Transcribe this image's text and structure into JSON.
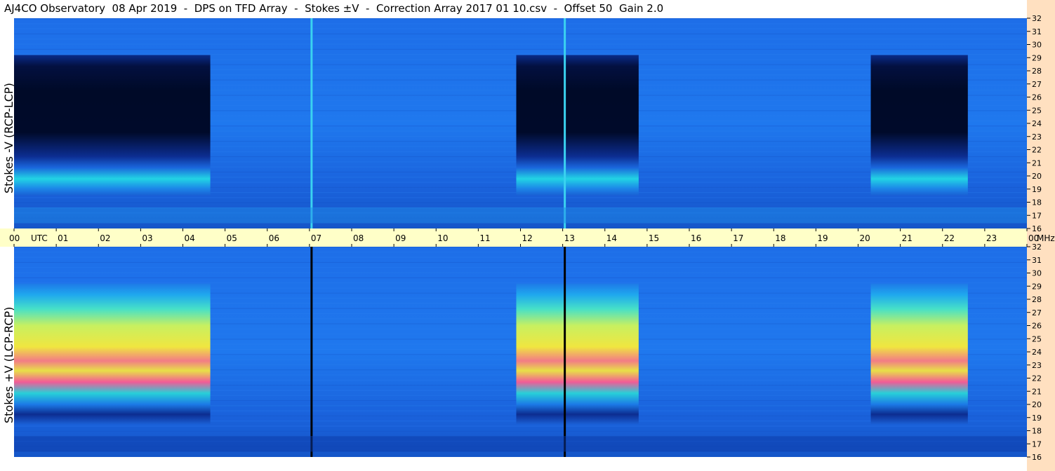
{
  "title": "AJ4CO Observatory  08 Apr 2019  -  DPS on TFD Array  -  Stokes ±V  -  Correction Array 2017 01 10.csv  -  Offset 50  Gain 2.0",
  "panels": {
    "top_label": "Stokes -V (RCP-LCP)",
    "bottom_label": "Stokes +V (LCP-RCP)"
  },
  "colors": {
    "background_blue": "#1a68e6",
    "axis_band": "#ffffc8",
    "right_strip": "#ffe0c0"
  },
  "chart_data": [
    {
      "type": "heatmap",
      "title": "Stokes -V (RCP-LCP)",
      "xlabel": "UTC",
      "ylabel": "MHz",
      "x_ticks": [
        "00",
        "01",
        "02",
        "03",
        "04",
        "05",
        "06",
        "07",
        "08",
        "09",
        "10",
        "11",
        "12",
        "13",
        "14",
        "15",
        "16",
        "17",
        "18",
        "19",
        "20",
        "21",
        "22",
        "23",
        "00"
      ],
      "y_ticks": [
        "16",
        "17",
        "18",
        "19",
        "20",
        "21",
        "22",
        "23",
        "24",
        "25",
        "26",
        "27",
        "28",
        "29",
        "30",
        "31",
        "32"
      ],
      "xlim": [
        0,
        24
      ],
      "ylim": [
        16,
        32
      ],
      "source_blocks": [
        {
          "start_utc": 0.0,
          "end_utc": 4.65,
          "low_mhz": 18.5,
          "high_mhz": 29.2
        },
        {
          "start_utc": 11.9,
          "end_utc": 14.8,
          "low_mhz": 18.5,
          "high_mhz": 29.2
        },
        {
          "start_utc": 20.3,
          "end_utc": 22.6,
          "low_mhz": 18.5,
          "high_mhz": 29.2
        }
      ],
      "vertical_lines_utc": [
        7.05,
        13.05
      ]
    },
    {
      "type": "heatmap",
      "title": "Stokes +V (LCP-RCP)",
      "xlabel": "UTC",
      "ylabel": "MHz",
      "x_ticks": [
        "00",
        "01",
        "02",
        "03",
        "04",
        "05",
        "06",
        "07",
        "08",
        "09",
        "10",
        "11",
        "12",
        "13",
        "14",
        "15",
        "16",
        "17",
        "18",
        "19",
        "20",
        "21",
        "22",
        "23",
        "00"
      ],
      "y_ticks": [
        "16",
        "17",
        "18",
        "19",
        "20",
        "21",
        "22",
        "23",
        "24",
        "25",
        "26",
        "27",
        "28",
        "29",
        "30",
        "31",
        "32"
      ],
      "xlim": [
        0,
        24
      ],
      "ylim": [
        16,
        32
      ],
      "source_blocks": [
        {
          "start_utc": 0.0,
          "end_utc": 4.65,
          "low_mhz": 18.5,
          "high_mhz": 29.2
        },
        {
          "start_utc": 11.9,
          "end_utc": 14.8,
          "low_mhz": 18.5,
          "high_mhz": 29.2
        },
        {
          "start_utc": 20.3,
          "end_utc": 22.6,
          "low_mhz": 18.5,
          "high_mhz": 29.2
        }
      ],
      "vertical_lines_utc": [
        7.05,
        13.05
      ]
    }
  ],
  "axis": {
    "x_ticks": [
      "00",
      "01",
      "02",
      "03",
      "04",
      "05",
      "06",
      "07",
      "08",
      "09",
      "10",
      "11",
      "12",
      "13",
      "14",
      "15",
      "16",
      "17",
      "18",
      "19",
      "20",
      "21",
      "22",
      "23",
      "00"
    ],
    "utc_label": "UTC",
    "mhz_label": "MHz",
    "y_ticks": [
      "16",
      "17",
      "18",
      "19",
      "20",
      "21",
      "22",
      "23",
      "24",
      "25",
      "26",
      "27",
      "28",
      "29",
      "30",
      "31",
      "32"
    ]
  }
}
